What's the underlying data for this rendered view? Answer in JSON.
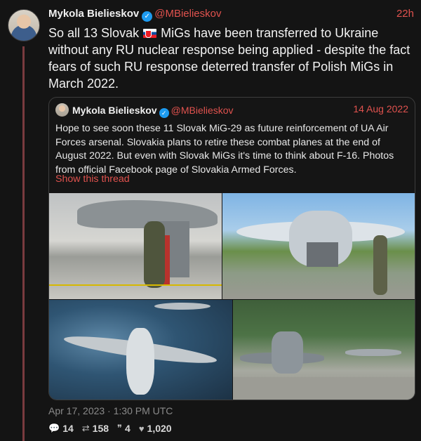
{
  "tweet": {
    "author_name": "Mykola Bielieskov",
    "handle": "@MBielieskov",
    "age": "22h",
    "text_before_flag": "So all 13 Slovak ",
    "text_after_flag": " MiGs have been transferred to Ukraine without any RU nuclear response being applied - despite the fact fears of such RU response deterred transfer of Polish MiGs in March 2022.",
    "timestamp": "Apr 17, 2023 · 1:30 PM UTC"
  },
  "quote": {
    "author_name": "Mykola Bielieskov",
    "handle": "@MBielieskov",
    "date": "14 Aug 2022",
    "text": "Hope to see soon these 11 Slovak MiG-29 as future reinforcement of UA Air Forces arsenal. Slovakia plans to retire these combat planes at the end of August 2022. But even with Slovak MiGs it's time to think about F-16. Photos from official Facebook page of Slovakia Armed Forces.",
    "show_thread": "Show this thread"
  },
  "stats": {
    "replies": "14",
    "retweets": "158",
    "quotes": "4",
    "likes": "1,020"
  },
  "icons": {
    "verified": "verified-badge-icon",
    "flag": "slovakia-flag-icon",
    "reply": "reply-icon",
    "retweet": "retweet-icon",
    "quote": "quote-icon",
    "like": "heart-icon"
  },
  "colors": {
    "background": "#141414",
    "accent": "#e0524e",
    "verified": "#1d9bf0",
    "thread_line": "#7a3b3f"
  }
}
